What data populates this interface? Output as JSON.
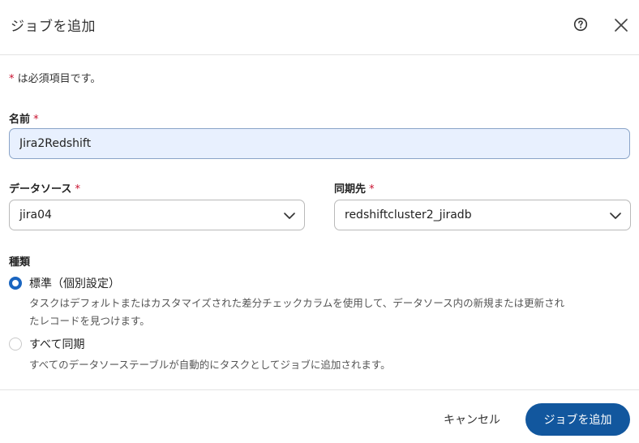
{
  "dialog": {
    "title": "ジョブを追加",
    "help_icon": "help-circle-icon",
    "close_icon": "close-icon"
  },
  "required_note": {
    "star": "*",
    "text": " は必須項目です。"
  },
  "fields": {
    "name": {
      "label": "名前",
      "star": " *",
      "value": "Jira2Redshift"
    },
    "data_source": {
      "label": "データソース",
      "star": " *",
      "value": "jira04"
    },
    "destination": {
      "label": "同期先",
      "star": " *",
      "value": "redshiftcluster2_jiradb"
    }
  },
  "type": {
    "label": "種類",
    "options": [
      {
        "label": "標準（個別設定）",
        "description_line1": "タスクはデフォルトまたはカスタマイズされた差分チェックカラムを使用して、データソース内の新規または更新され",
        "description_line2": "たレコードを見つけます。",
        "checked": true
      },
      {
        "label": "すべて同期",
        "description_line1": "すべてのデータソーステーブルが自動的にタスクとしてジョブに追加されます。",
        "checked": false
      }
    ]
  },
  "footer": {
    "cancel_label": "キャンセル",
    "submit_label": "ジョブを追加"
  },
  "colors": {
    "accent": "#12579e",
    "radio": "#1a65c0",
    "required": "#c8102e",
    "input_fill": "#e8f0fe"
  }
}
